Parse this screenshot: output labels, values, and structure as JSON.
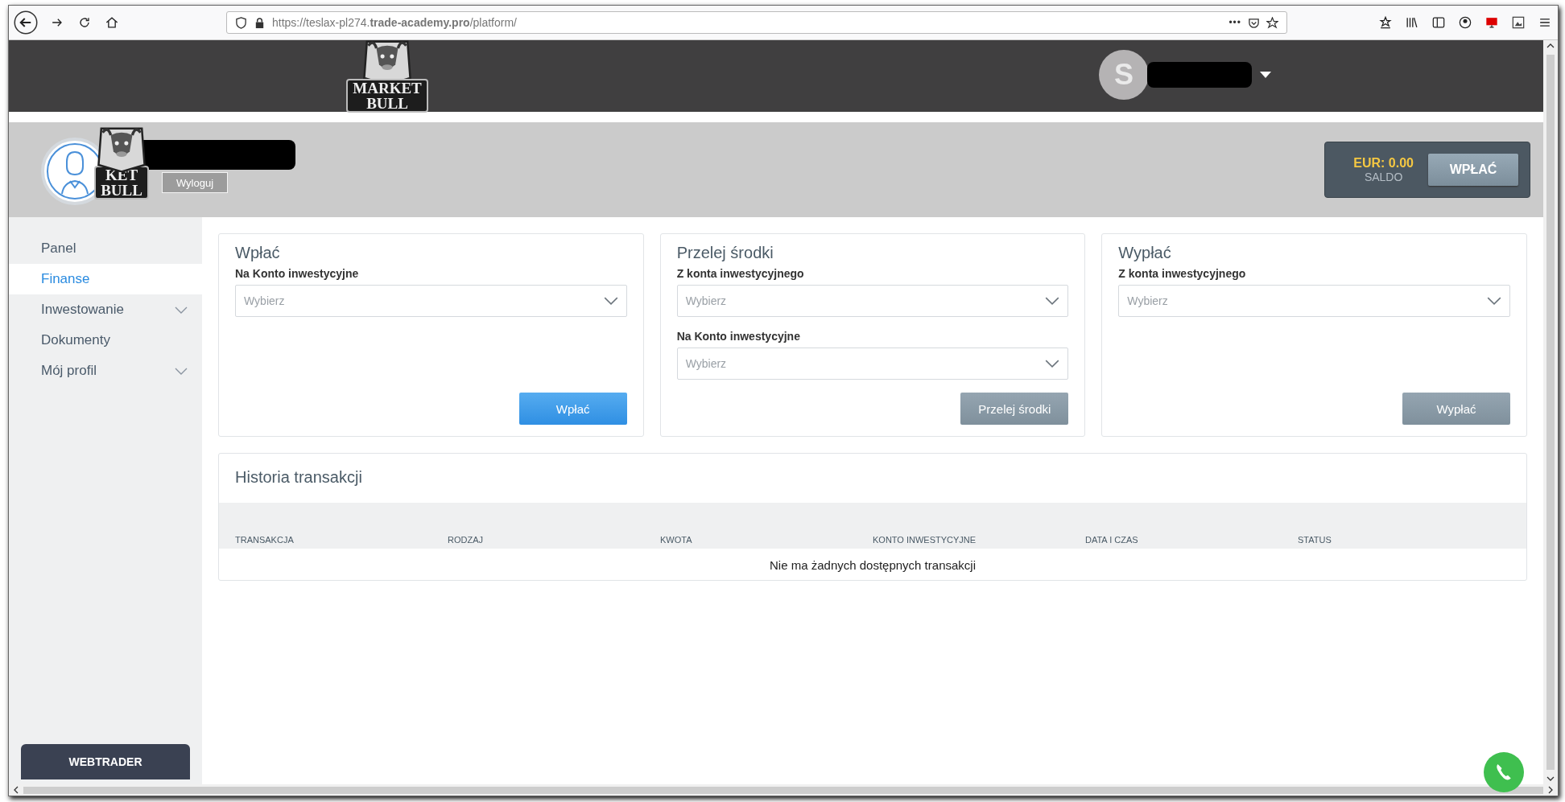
{
  "browser": {
    "url": "https://teslax-pl274.**trade-academy.pro**/platform/",
    "menu_dots": "•••"
  },
  "header": {
    "logo_text": [
      "MARKET",
      "BULL"
    ],
    "user_initial": "S"
  },
  "profile": {
    "logo_text": [
      "KET",
      "BULL"
    ],
    "logout": "Wyloguj",
    "balance": "EUR: 0.00",
    "balance_label": "SALDO",
    "deposit_button": "WPŁAĆ"
  },
  "sidebar": {
    "items": [
      {
        "label": "Panel",
        "selected": false,
        "expandable": false
      },
      {
        "label": "Finanse",
        "selected": true,
        "expandable": false
      },
      {
        "label": "Inwestowanie",
        "selected": false,
        "expandable": true
      },
      {
        "label": "Dokumenty",
        "selected": false,
        "expandable": false
      },
      {
        "label": "Mój profil",
        "selected": false,
        "expandable": true
      }
    ],
    "webtrader": "WEBTRADER"
  },
  "cards": [
    {
      "title": "Wpłać",
      "fields": [
        {
          "label": "Na Konto inwestycyjne",
          "placeholder": "Wybierz"
        }
      ],
      "button": {
        "label": "Wpłać",
        "disabled": false
      }
    },
    {
      "title": "Przelej środki",
      "fields": [
        {
          "label": "Z konta inwestycyjnego",
          "placeholder": "Wybierz"
        },
        {
          "label": "Na Konto inwestycyjne",
          "placeholder": "Wybierz"
        }
      ],
      "button": {
        "label": "Przelej środki",
        "disabled": true
      }
    },
    {
      "title": "Wypłać",
      "fields": [
        {
          "label": "Z konta inwestycyjnego",
          "placeholder": "Wybierz"
        }
      ],
      "button": {
        "label": "Wypłać",
        "disabled": true
      }
    }
  ],
  "history": {
    "title": "Historia transakcji",
    "columns": [
      "TRANSAKCJA",
      "RODZAJ",
      "KWOTA",
      "KONTO INWESTYCYJNE",
      "DATA I CZAS",
      "STATUS"
    ],
    "empty_message": "Nie ma żadnych dostępnych transakcji"
  }
}
